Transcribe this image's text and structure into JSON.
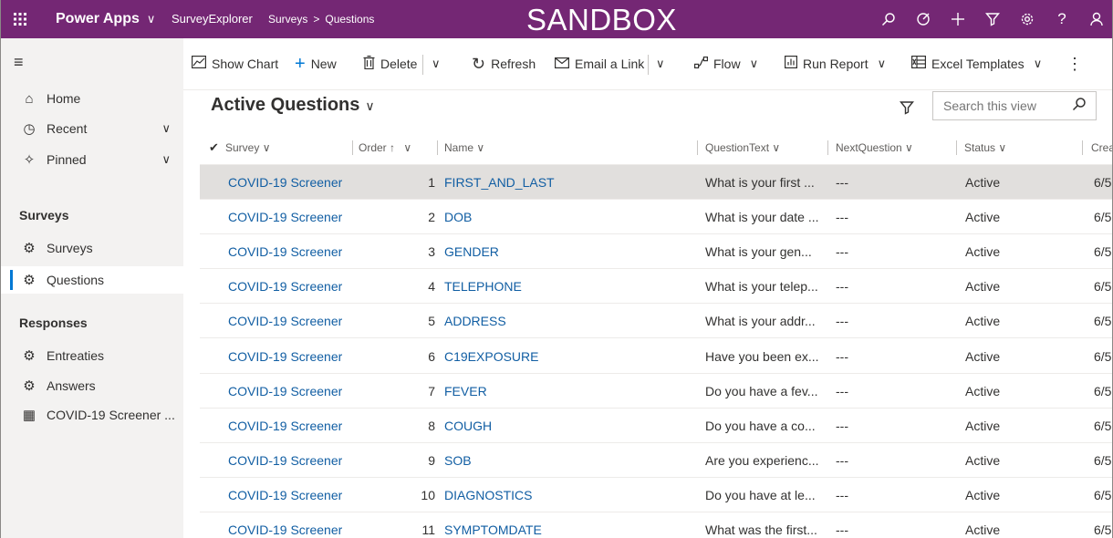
{
  "topbar": {
    "app_name": "Power Apps",
    "app_module": "SurveyExplorer",
    "breadcrumb": [
      "Surveys",
      "Questions"
    ],
    "environment_banner": "SANDBOX",
    "icons": [
      "search-icon",
      "lightbulb-icon",
      "plus-icon",
      "filter-icon",
      "gear-icon",
      "help-icon",
      "user-icon"
    ]
  },
  "commandbar": {
    "show_chart": "Show Chart",
    "new": "New",
    "delete": "Delete",
    "refresh": "Refresh",
    "email_link": "Email a Link",
    "flow": "Flow",
    "run_report": "Run Report",
    "excel_templates": "Excel Templates"
  },
  "sidebar": {
    "home": "Home",
    "recent": "Recent",
    "pinned": "Pinned",
    "group_surveys": "Surveys",
    "surveys": "Surveys",
    "questions": "Questions",
    "group_responses": "Responses",
    "entreaties": "Entreaties",
    "answers": "Answers",
    "screener": "COVID-19 Screener ..."
  },
  "view": {
    "title": "Active Questions",
    "search_placeholder": "Search this view"
  },
  "grid": {
    "columns": [
      "Survey",
      "Order",
      "Name",
      "QuestionText",
      "NextQuestion",
      "Status",
      "Crea"
    ],
    "rows": [
      {
        "survey": "COVID-19 Screener",
        "order": "1",
        "name": "FIRST_AND_LAST",
        "text": "What is your first ...",
        "next": "---",
        "status": "Active",
        "created": "6/5"
      },
      {
        "survey": "COVID-19 Screener",
        "order": "2",
        "name": "DOB",
        "text": "What is your date ...",
        "next": "---",
        "status": "Active",
        "created": "6/5"
      },
      {
        "survey": "COVID-19 Screener",
        "order": "3",
        "name": "GENDER",
        "text": "What is your gen...",
        "next": "---",
        "status": "Active",
        "created": "6/5"
      },
      {
        "survey": "COVID-19 Screener",
        "order": "4",
        "name": "TELEPHONE",
        "text": "What is your telep...",
        "next": "---",
        "status": "Active",
        "created": "6/5"
      },
      {
        "survey": "COVID-19 Screener",
        "order": "5",
        "name": "ADDRESS",
        "text": "What is your addr...",
        "next": "---",
        "status": "Active",
        "created": "6/5"
      },
      {
        "survey": "COVID-19 Screener",
        "order": "6",
        "name": "C19EXPOSURE",
        "text": "Have you been ex...",
        "next": "---",
        "status": "Active",
        "created": "6/5"
      },
      {
        "survey": "COVID-19 Screener",
        "order": "7",
        "name": "FEVER",
        "text": "Do you have a fev...",
        "next": "---",
        "status": "Active",
        "created": "6/5"
      },
      {
        "survey": "COVID-19 Screener",
        "order": "8",
        "name": "COUGH",
        "text": "Do you have a co...",
        "next": "---",
        "status": "Active",
        "created": "6/5"
      },
      {
        "survey": "COVID-19 Screener",
        "order": "9",
        "name": "SOB",
        "text": "Are you experienc...",
        "next": "---",
        "status": "Active",
        "created": "6/5"
      },
      {
        "survey": "COVID-19 Screener",
        "order": "10",
        "name": "DIAGNOSTICS",
        "text": "Do you have at le...",
        "next": "---",
        "status": "Active",
        "created": "6/5"
      },
      {
        "survey": "COVID-19 Screener",
        "order": "11",
        "name": "SYMPTOMDATE",
        "text": "What was the first...",
        "next": "---",
        "status": "Active",
        "created": "6/5"
      }
    ]
  },
  "colors": {
    "topbar": "#742774",
    "link": "#115ea3",
    "selected_row": "#e1dfdd",
    "nav_bg": "#f3f2f1",
    "accent": "#0078d4"
  }
}
